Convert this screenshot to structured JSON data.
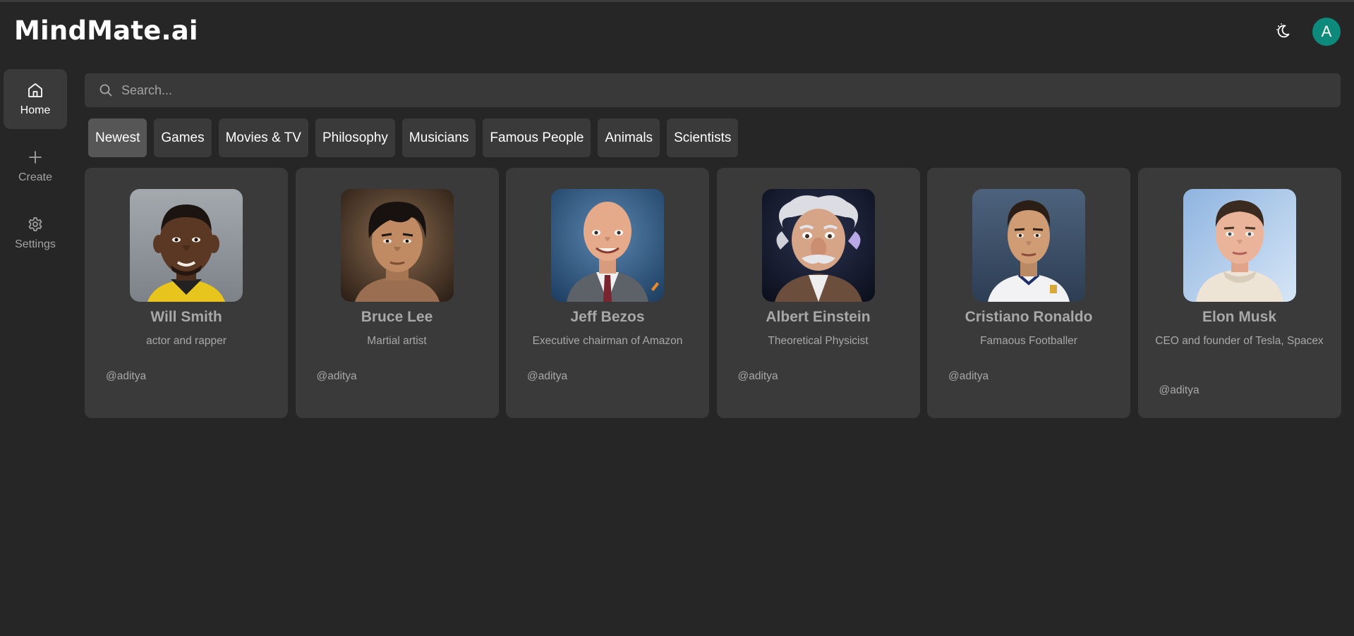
{
  "header": {
    "logo": "MindMate.ai",
    "avatar_initial": "A",
    "theme_toggle_icon": "moon-icon"
  },
  "sidebar": {
    "items": [
      {
        "label": "Home",
        "icon": "home-icon"
      },
      {
        "label": "Create",
        "icon": "plus-icon"
      },
      {
        "label": "Settings",
        "icon": "gear-icon"
      }
    ]
  },
  "search": {
    "placeholder": "Search...",
    "value": ""
  },
  "categories": [
    "Newest",
    "Games",
    "Movies & TV",
    "Philosophy",
    "Musicians",
    "Famous People",
    "Animals",
    "Scientists"
  ],
  "companions": [
    {
      "name": "Will Smith",
      "description": "actor and rapper",
      "author": "@aditya"
    },
    {
      "name": "Bruce Lee",
      "description": "Martial artist",
      "author": "@aditya"
    },
    {
      "name": "Jeff Bezos",
      "description": "Executive chairman of Amazon",
      "author": "@aditya"
    },
    {
      "name": "Albert Einstein",
      "description": "Theoretical Physicist",
      "author": "@aditya"
    },
    {
      "name": "Cristiano Ronaldo",
      "description": "Famaous Footballer",
      "author": "@aditya"
    },
    {
      "name": "Elon Musk",
      "description": "CEO and founder of Tesla, Spacex",
      "author": "@aditya"
    }
  ],
  "colors": {
    "background": "#262626",
    "surface": "#3a3a3a",
    "avatar": "#0e8a7c",
    "muted_text": "#a8a8a8"
  }
}
